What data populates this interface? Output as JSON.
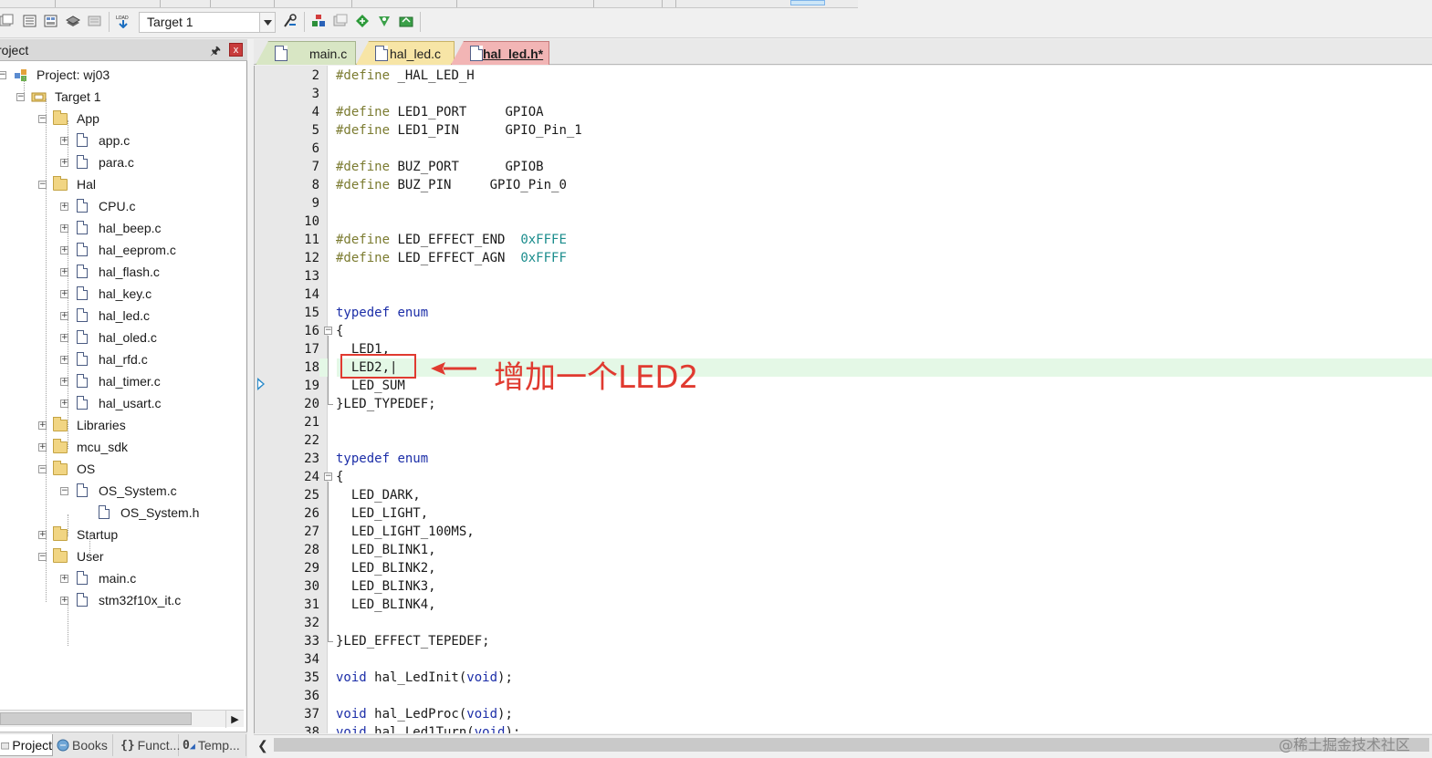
{
  "toolbar": {
    "target_select": "Target 1",
    "icons": [
      "translate-icon",
      "build-icon",
      "rebuild-icon",
      "batch-build-icon",
      "stop-build-icon",
      "load-icon",
      "target-options-icon",
      "manage-components-icon",
      "select-packs-icon",
      "pack-installer-icon",
      "rte-icon"
    ]
  },
  "project_panel": {
    "title": "roject",
    "tree": [
      {
        "label": "Project: wj03",
        "kind": "project",
        "level": 0,
        "expanded": true
      },
      {
        "label": "Target 1",
        "kind": "target",
        "level": 1,
        "expanded": true
      },
      {
        "label": "App",
        "kind": "folder",
        "level": 2,
        "expanded": true
      },
      {
        "label": "app.c",
        "kind": "file",
        "level": 3,
        "expandable": true
      },
      {
        "label": "para.c",
        "kind": "file",
        "level": 3,
        "expandable": true
      },
      {
        "label": "Hal",
        "kind": "folder",
        "level": 2,
        "expanded": true
      },
      {
        "label": "CPU.c",
        "kind": "file",
        "level": 3,
        "expandable": true
      },
      {
        "label": "hal_beep.c",
        "kind": "file",
        "level": 3,
        "expandable": true
      },
      {
        "label": "hal_eeprom.c",
        "kind": "file",
        "level": 3,
        "expandable": true
      },
      {
        "label": "hal_flash.c",
        "kind": "file",
        "level": 3,
        "expandable": true
      },
      {
        "label": "hal_key.c",
        "kind": "file",
        "level": 3,
        "expandable": true
      },
      {
        "label": "hal_led.c",
        "kind": "file",
        "level": 3,
        "expandable": true
      },
      {
        "label": "hal_oled.c",
        "kind": "file",
        "level": 3,
        "expandable": true
      },
      {
        "label": "hal_rfd.c",
        "kind": "file",
        "level": 3,
        "expandable": true
      },
      {
        "label": "hal_timer.c",
        "kind": "file",
        "level": 3,
        "expandable": true
      },
      {
        "label": "hal_usart.c",
        "kind": "file",
        "level": 3,
        "expandable": true
      },
      {
        "label": "Libraries",
        "kind": "folder",
        "level": 2,
        "expanded": false
      },
      {
        "label": "mcu_sdk",
        "kind": "folder",
        "level": 2,
        "expanded": false
      },
      {
        "label": "OS",
        "kind": "folder",
        "level": 2,
        "expanded": true
      },
      {
        "label": "OS_System.c",
        "kind": "file",
        "level": 3,
        "expanded": true
      },
      {
        "label": "OS_System.h",
        "kind": "file",
        "level": 4,
        "expandable": false
      },
      {
        "label": "Startup",
        "kind": "folder",
        "level": 2,
        "expanded": false
      },
      {
        "label": "User",
        "kind": "folder",
        "level": 2,
        "expanded": true
      },
      {
        "label": "main.c",
        "kind": "file",
        "level": 3,
        "expandable": true
      },
      {
        "label": "stm32f10x_it.c",
        "kind": "file",
        "level": 3,
        "expandable": true
      }
    ],
    "tabs": [
      {
        "label": "Project",
        "active": true
      },
      {
        "label": "Books",
        "active": false
      },
      {
        "label": "Funct...",
        "active": false
      },
      {
        "label": "Temp...",
        "active": false
      }
    ]
  },
  "editor": {
    "tabs": [
      {
        "label": "main.c",
        "color": "#d8e6c4"
      },
      {
        "label": "hal_led.c",
        "color": "#f7e5a6"
      },
      {
        "label": "hal_led.h*",
        "color": "#f2b5b5",
        "active": true
      }
    ],
    "current_line": 18,
    "lines": [
      {
        "n": "2",
        "segs": [
          [
            "pp",
            "#define"
          ],
          [
            "t",
            " _HAL_LED_H"
          ]
        ]
      },
      {
        "n": "3",
        "segs": []
      },
      {
        "n": "4",
        "segs": [
          [
            "pp",
            "#define"
          ],
          [
            "t",
            " LED1_PORT     GPIOA"
          ]
        ]
      },
      {
        "n": "5",
        "segs": [
          [
            "pp",
            "#define"
          ],
          [
            "t",
            " LED1_PIN      GPIO_Pin_1"
          ]
        ]
      },
      {
        "n": "6",
        "segs": []
      },
      {
        "n": "7",
        "segs": [
          [
            "pp",
            "#define"
          ],
          [
            "t",
            " BUZ_PORT      GPIOB"
          ]
        ]
      },
      {
        "n": "8",
        "segs": [
          [
            "pp",
            "#define"
          ],
          [
            "t",
            " BUZ_PIN     GPIO_Pin_0"
          ]
        ]
      },
      {
        "n": "9",
        "segs": []
      },
      {
        "n": "10",
        "segs": []
      },
      {
        "n": "11",
        "segs": [
          [
            "pp",
            "#define"
          ],
          [
            "t",
            " LED_EFFECT_END  "
          ],
          [
            "num",
            "0xFFFE"
          ]
        ]
      },
      {
        "n": "12",
        "segs": [
          [
            "pp",
            "#define"
          ],
          [
            "t",
            " LED_EFFECT_AGN  "
          ],
          [
            "num",
            "0xFFFF"
          ]
        ]
      },
      {
        "n": "13",
        "segs": []
      },
      {
        "n": "14",
        "segs": []
      },
      {
        "n": "15",
        "segs": [
          [
            "kw",
            "typedef"
          ],
          [
            "t",
            " "
          ],
          [
            "kw",
            "enum"
          ]
        ]
      },
      {
        "n": "16",
        "segs": [
          [
            "t",
            "{"
          ]
        ],
        "fold": "open"
      },
      {
        "n": "17",
        "segs": [
          [
            "t",
            "  LED1,"
          ]
        ]
      },
      {
        "n": "18",
        "segs": [
          [
            "t",
            "  LED2,|"
          ]
        ]
      },
      {
        "n": "19",
        "segs": [
          [
            "t",
            "  LED_SUM"
          ]
        ]
      },
      {
        "n": "20",
        "segs": [
          [
            "t",
            "}LED_TYPEDEF;"
          ]
        ],
        "fold": "end"
      },
      {
        "n": "21",
        "segs": []
      },
      {
        "n": "22",
        "segs": []
      },
      {
        "n": "23",
        "segs": [
          [
            "kw",
            "typedef"
          ],
          [
            "t",
            " "
          ],
          [
            "kw",
            "enum"
          ]
        ]
      },
      {
        "n": "24",
        "segs": [
          [
            "t",
            "{"
          ]
        ],
        "fold": "open"
      },
      {
        "n": "25",
        "segs": [
          [
            "t",
            "  LED_DARK,"
          ]
        ]
      },
      {
        "n": "26",
        "segs": [
          [
            "t",
            "  LED_LIGHT,"
          ]
        ]
      },
      {
        "n": "27",
        "segs": [
          [
            "t",
            "  LED_LIGHT_100MS,"
          ]
        ]
      },
      {
        "n": "28",
        "segs": [
          [
            "t",
            "  LED_BLINK1,"
          ]
        ]
      },
      {
        "n": "29",
        "segs": [
          [
            "t",
            "  LED_BLINK2,"
          ]
        ]
      },
      {
        "n": "30",
        "segs": [
          [
            "t",
            "  LED_BLINK3,"
          ]
        ]
      },
      {
        "n": "31",
        "segs": [
          [
            "t",
            "  LED_BLINK4,"
          ]
        ]
      },
      {
        "n": "32",
        "segs": []
      },
      {
        "n": "33",
        "segs": [
          [
            "t",
            "}LED_EFFECT_TEPEDEF;"
          ]
        ],
        "fold": "end"
      },
      {
        "n": "34",
        "segs": []
      },
      {
        "n": "35",
        "segs": [
          [
            "kw",
            "void"
          ],
          [
            "t",
            " hal_LedInit("
          ],
          [
            "kw",
            "void"
          ],
          [
            "t",
            ");"
          ]
        ]
      },
      {
        "n": "36",
        "segs": []
      },
      {
        "n": "37",
        "segs": [
          [
            "kw",
            "void"
          ],
          [
            "t",
            " hal_LedProc("
          ],
          [
            "kw",
            "void"
          ],
          [
            "t",
            ");"
          ]
        ]
      },
      {
        "n": "38",
        "segs": [
          [
            "kw",
            "void"
          ],
          [
            "t",
            " hal_Led1Turn("
          ],
          [
            "kw",
            "void"
          ],
          [
            "t",
            ");"
          ]
        ]
      }
    ]
  },
  "annotation": {
    "text": "增加一个LED2",
    "color": "#e03a30"
  },
  "watermark": "@稀土掘金技术社区"
}
